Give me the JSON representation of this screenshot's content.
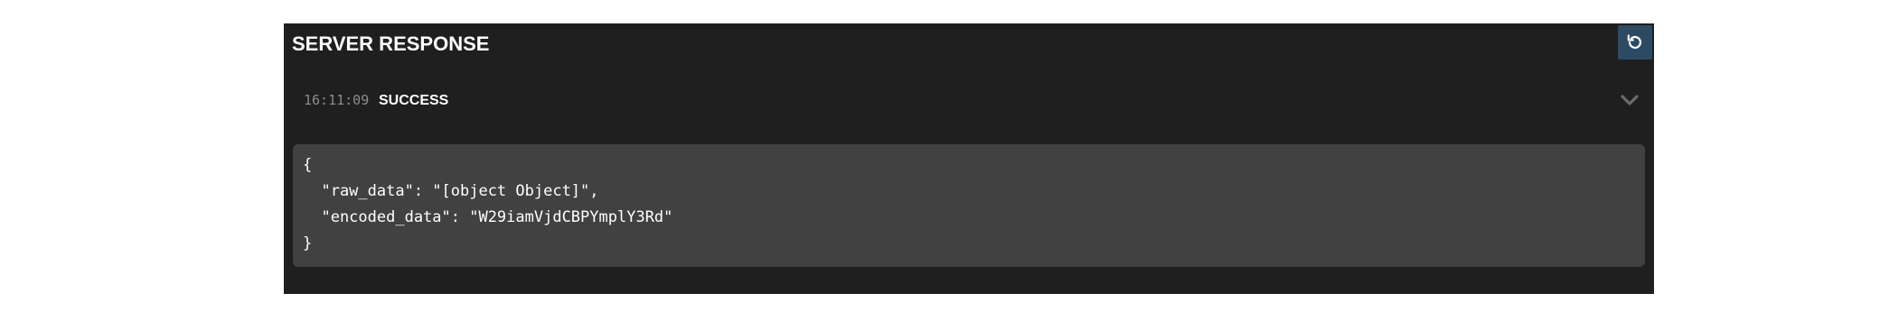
{
  "panel": {
    "title": "SERVER RESPONSE",
    "refresh_icon": "refresh-icon",
    "collapse_icon": "chevron-down-icon"
  },
  "response": {
    "timestamp": "16:11:09",
    "status": "SUCCESS",
    "body_lines": [
      "{",
      "  \"raw_data\": \"[object Object]\",",
      "  \"encoded_data\": \"W29iamVjdCBPYmplY3Rd\"",
      "}"
    ]
  },
  "colors": {
    "panel_background": "#1f1f1f",
    "code_background": "#414141",
    "refresh_button": "#2d4a63"
  }
}
